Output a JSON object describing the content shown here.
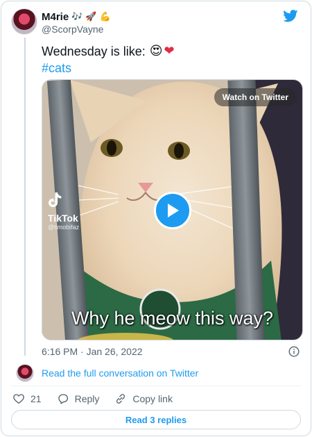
{
  "author": {
    "display_name": "M4rie",
    "name_emojis": [
      "🎶",
      "🚀",
      "💪"
    ],
    "handle": "@ScorpVayne"
  },
  "tweet": {
    "text": "Wednesday is like:",
    "emojis": [
      "😍",
      "❤"
    ],
    "hashtag": "#cats"
  },
  "media": {
    "watch_label": "Watch on Twitter",
    "tiktok_label": "TikTok",
    "tiktok_user": "@timobifaz",
    "caption": "Why he meow this way?"
  },
  "meta": {
    "timestamp": "6:16 PM · Jan 26, 2022"
  },
  "conversation": {
    "link_text": "Read the full conversation on Twitter"
  },
  "actions": {
    "like_count": "21",
    "reply_label": "Reply",
    "copy_label": "Copy link"
  },
  "replies_button": "Read 3 replies",
  "colors": {
    "accent": "#1d9bf0",
    "muted_text": "#536471",
    "border": "#cfd9de"
  },
  "icons": [
    "twitter-bird-icon",
    "play-icon",
    "info-icon",
    "heart-icon",
    "reply-icon",
    "link-icon",
    "tiktok-icon"
  ]
}
